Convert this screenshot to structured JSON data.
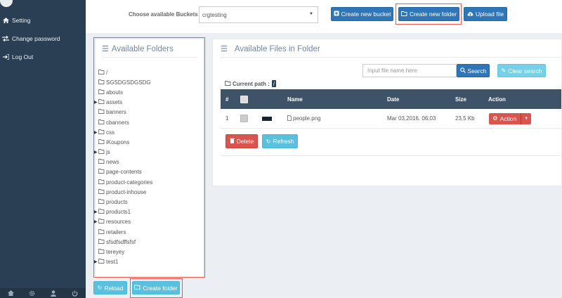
{
  "sidebar": {
    "items": [
      {
        "label": "Setting",
        "icon": "home-icon"
      },
      {
        "label": "Change password",
        "icon": "swap-icon"
      },
      {
        "label": "Log Out",
        "icon": "logout-icon"
      }
    ],
    "footer_icons": [
      "home-icon",
      "gear-icon",
      "user-icon",
      "power-icon"
    ]
  },
  "toolbar": {
    "bucket_label": "Choose available Buckets",
    "bucket_value": "crgtesting",
    "create_bucket_label": "Create new bucket",
    "create_folder_label": "Create new folder",
    "upload_label": "Upload file"
  },
  "folders": {
    "title": "Available Folders",
    "items": [
      {
        "name": "/",
        "expandable": false
      },
      {
        "name": "SGSDGSDGSDG",
        "expandable": false
      },
      {
        "name": "abouts",
        "expandable": false
      },
      {
        "name": "assets",
        "expandable": true
      },
      {
        "name": "banners",
        "expandable": false
      },
      {
        "name": "cbanners",
        "expandable": false
      },
      {
        "name": "css",
        "expandable": true
      },
      {
        "name": "iKoupons",
        "expandable": false
      },
      {
        "name": "js",
        "expandable": true
      },
      {
        "name": "news",
        "expandable": false
      },
      {
        "name": "page-contents",
        "expandable": false
      },
      {
        "name": "product-categories",
        "expandable": false
      },
      {
        "name": "product-inhouse",
        "expandable": false
      },
      {
        "name": "products",
        "expandable": false
      },
      {
        "name": "products1",
        "expandable": true
      },
      {
        "name": "resources",
        "expandable": true
      },
      {
        "name": "retailers",
        "expandable": false
      },
      {
        "name": "sfsdfsdffsfsf",
        "expandable": false
      },
      {
        "name": "tereyey",
        "expandable": false
      },
      {
        "name": "test1",
        "expandable": true
      }
    ],
    "reload_label": "Reload",
    "create_folder_label": "Create folder"
  },
  "files": {
    "title": "Available Files in Folder",
    "search_placeholder": "Input file name here",
    "search_label": "Search",
    "clear_label": "Clear search",
    "current_path_label": "Current path :",
    "current_path_value": "/",
    "columns": [
      "#",
      "Name",
      "Date",
      "Size",
      "Action"
    ],
    "rows": [
      {
        "index": "1",
        "name": "people.png",
        "date": "Mar 03,2016. 06:03",
        "size": "23,5 Kb",
        "action_label": "Action"
      }
    ],
    "delete_label": "Delete",
    "refresh_label": "Refresh"
  },
  "colors": {
    "sidebar": "#2a3f54",
    "primary": "#2f76b8",
    "info": "#5bc0de",
    "danger": "#d9534f",
    "highlight": "#e85a4f"
  }
}
